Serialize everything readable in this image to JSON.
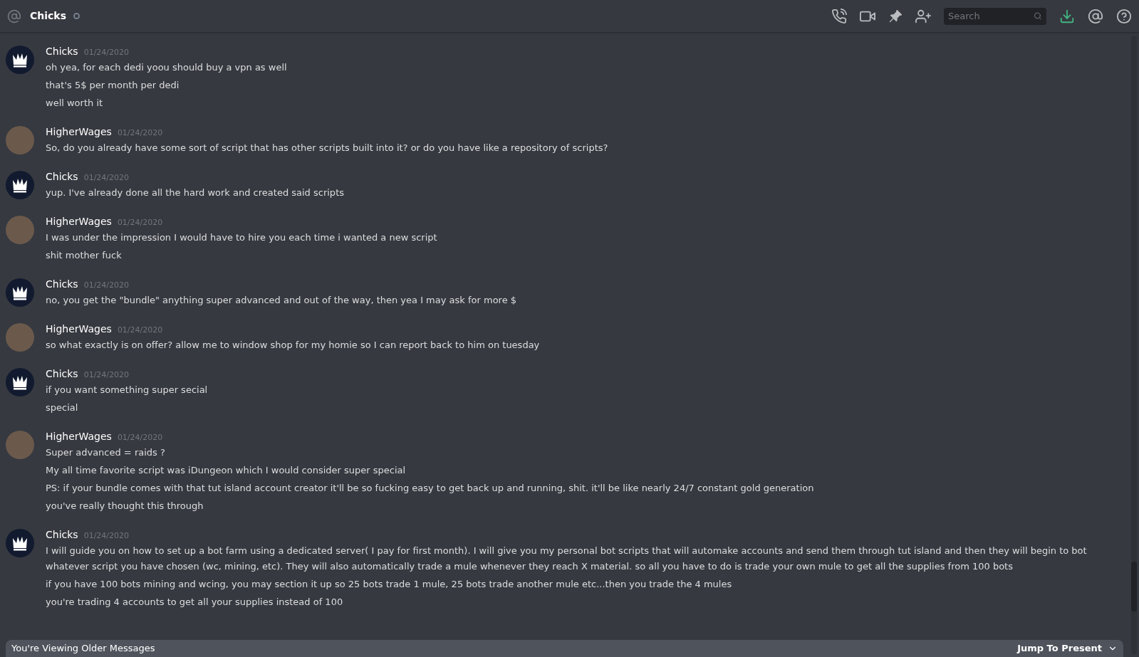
{
  "header": {
    "channel": "Chicks",
    "search": {
      "placeholder": "Search"
    }
  },
  "messages": [
    {
      "author": "Chicks",
      "kind": "crown",
      "date": "01/24/2020",
      "lines": [
        "oh yea, for each dedi yoou should buy a vpn as well",
        "that's 5$ per month per dedi",
        "well worth it"
      ]
    },
    {
      "author": "HigherWages",
      "kind": "photo",
      "date": "01/24/2020",
      "lines": [
        "So, do you already have some sort of script that has other scripts built into it? or do you have like a repository of scripts?"
      ]
    },
    {
      "author": "Chicks",
      "kind": "crown",
      "date": "01/24/2020",
      "lines": [
        "yup. I've already done all the hard work and created said scripts"
      ]
    },
    {
      "author": "HigherWages",
      "kind": "photo",
      "date": "01/24/2020",
      "lines": [
        "I was under the impression I would have to hire you each time i wanted a new script",
        "shit mother fuck"
      ]
    },
    {
      "author": "Chicks",
      "kind": "crown",
      "date": "01/24/2020",
      "lines": [
        "no, you get the \"bundle\" anything super advanced and out of the way, then yea I may ask for more $"
      ]
    },
    {
      "author": "HigherWages",
      "kind": "photo",
      "date": "01/24/2020",
      "lines": [
        "so what exactly is on offer? allow me to window shop for my homie so I can report back to him on tuesday"
      ]
    },
    {
      "author": "Chicks",
      "kind": "crown",
      "date": "01/24/2020",
      "lines": [
        "if you want something super secial",
        "special"
      ]
    },
    {
      "author": "HigherWages",
      "kind": "photo",
      "date": "01/24/2020",
      "lines": [
        "Super advanced = raids ?",
        "My all time favorite script was iDungeon which I would consider super special",
        "PS: if your bundle comes with that tut island account creator it'll be so fucking easy to get back up and running, shit. it'll be like nearly 24/7 constant gold generation",
        "you've really thought this through"
      ]
    },
    {
      "author": "Chicks",
      "kind": "crown",
      "date": "01/24/2020",
      "lines": [
        "I will guide you on how to set up a bot farm using a dedicated server( I pay for first month). I will give you my personal bot scripts that will automake accounts and send them through tut island and then they will begin to bot whatever script you have chosen (wc, mining, etc). They will also automatically trade a mule whenever they reach X material. so all you have to do is trade your own mule to get all the supplies from 100 bots",
        "if you have 100 bots mining and wcing, you may section it up so 25 bots trade 1 mule, 25 bots trade another mule etc...then you trade the 4 mules",
        "you're trading 4 accounts to get all your supplies instead of 100"
      ]
    }
  ],
  "banner": {
    "text": "You're Viewing Older Messages",
    "action": "Jump To Present"
  }
}
